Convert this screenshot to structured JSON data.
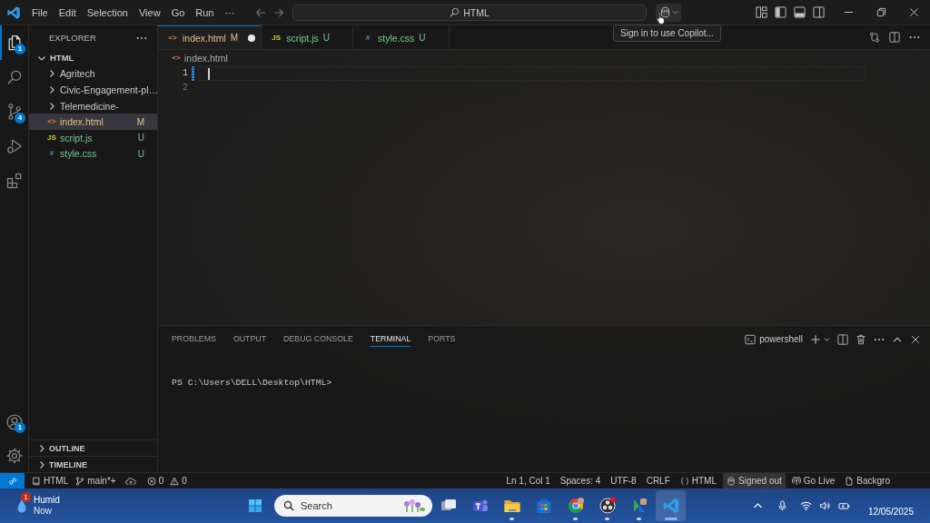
{
  "title_bar": {
    "menu": [
      "File",
      "Edit",
      "Selection",
      "View",
      "Go",
      "Run",
      "···"
    ],
    "command_center": "HTML",
    "tooltip": "Sign in to use Copilot..."
  },
  "activity_bar": {
    "top": [
      {
        "kind": "explorer",
        "selected": true,
        "badge": "1"
      },
      {
        "kind": "search",
        "selected": false
      },
      {
        "kind": "source-control",
        "selected": false,
        "badge": "4"
      },
      {
        "kind": "run-debug",
        "selected": false
      },
      {
        "kind": "extensions",
        "selected": false
      }
    ],
    "bottom": [
      {
        "kind": "account",
        "badge": "1"
      },
      {
        "kind": "settings"
      }
    ]
  },
  "sidebar": {
    "title": "EXPLORER",
    "tree": [
      {
        "kind": "folder",
        "label": "HTML",
        "expanded": true,
        "selected": false,
        "children": [
          {
            "kind": "folder",
            "label": "Agritech",
            "expanded": false,
            "selected": false
          },
          {
            "kind": "folder",
            "label": "Civic-Engagement-pl…",
            "expanded": false,
            "selected": false
          },
          {
            "kind": "folder",
            "label": "Telemedicine-",
            "expanded": false,
            "selected": false
          },
          {
            "kind": "html",
            "icon": "<>",
            "label": "index.html",
            "status": "M",
            "selected": true
          },
          {
            "kind": "js",
            "icon": "JS",
            "label": "script.js",
            "status": "U",
            "selected": false
          },
          {
            "kind": "css",
            "icon": "#",
            "label": "style.css",
            "status": "U",
            "selected": false
          }
        ]
      }
    ],
    "sections": [
      {
        "label": "OUTLINE",
        "expanded": false
      },
      {
        "label": "TIMELINE",
        "expanded": false
      }
    ]
  },
  "editor": {
    "tabs": [
      {
        "kind": "html",
        "icon": "<>",
        "label": "index.html",
        "status": "M",
        "selected": true,
        "unsaved": true
      },
      {
        "kind": "js",
        "icon": "JS",
        "label": "script.js",
        "status": "U",
        "selected": false,
        "unsaved": false
      },
      {
        "kind": "css",
        "icon": "#",
        "label": "style.css",
        "status": "U",
        "selected": false,
        "unsaved": false
      }
    ],
    "breadcrumb": {
      "kind": "html",
      "icon": "<>",
      "label": "index.html"
    },
    "lines": [
      {
        "number": "1",
        "current": true,
        "modified": true
      },
      {
        "number": "2",
        "current": false,
        "modified": false
      }
    ]
  },
  "panel": {
    "tabs": [
      {
        "label": "PROBLEMS",
        "selected": false
      },
      {
        "label": "OUTPUT",
        "selected": false
      },
      {
        "label": "DEBUG CONSOLE",
        "selected": false
      },
      {
        "label": "TERMINAL",
        "selected": true
      },
      {
        "label": "PORTS",
        "selected": false
      }
    ],
    "terminal_name": "powershell",
    "prompt": "PS C:\\Users\\DELL\\Desktop\\HTML>"
  },
  "status_bar": {
    "left": [
      {
        "kind": "remote"
      },
      {
        "kind": "project",
        "label": "HTML"
      },
      {
        "kind": "branch",
        "label": "main*+"
      },
      {
        "kind": "sync"
      },
      {
        "kind": "problems",
        "errors": "0",
        "warnings": "0"
      }
    ],
    "right": [
      {
        "kind": "text",
        "label": "Ln 1, Col 1",
        "highlighted": false
      },
      {
        "kind": "text",
        "label": "Spaces: 4",
        "highlighted": false
      },
      {
        "kind": "text",
        "label": "UTF-8",
        "highlighted": false
      },
      {
        "kind": "text",
        "label": "CRLF",
        "highlighted": false
      },
      {
        "kind": "language",
        "label": "HTML",
        "highlighted": false
      },
      {
        "kind": "copilot",
        "label": "Signed out",
        "highlighted": true
      },
      {
        "kind": "live",
        "label": "Go Live",
        "highlighted": false
      },
      {
        "kind": "file",
        "label": "Backgro",
        "highlighted": false
      }
    ]
  },
  "taskbar": {
    "weather": {
      "badge": "1",
      "title": "Humid",
      "subtitle": "Now"
    },
    "search": {
      "placeholder": "Search"
    },
    "apps": [
      {
        "kind": "task-view",
        "running": false,
        "selected": false
      },
      {
        "kind": "teams",
        "running": false,
        "selected": false
      },
      {
        "kind": "file-explorer",
        "running": true,
        "selected": false
      },
      {
        "kind": "store",
        "running": false,
        "selected": false
      },
      {
        "kind": "chrome",
        "running": true,
        "selected": false
      },
      {
        "kind": "obs",
        "running": true,
        "selected": false
      },
      {
        "kind": "app",
        "running": true,
        "selected": false
      },
      {
        "kind": "vscode",
        "running": true,
        "selected": true
      }
    ],
    "date": "12/05/2025"
  }
}
